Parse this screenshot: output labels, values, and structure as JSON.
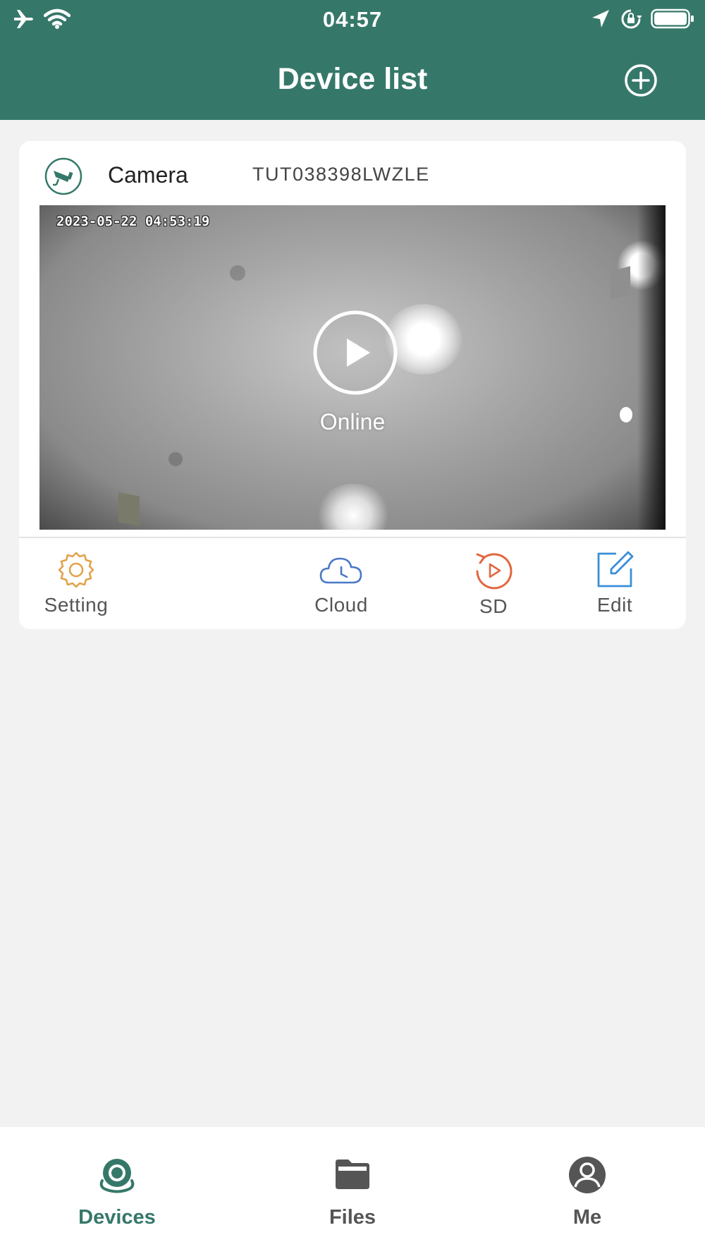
{
  "status_bar": {
    "time": "04:57"
  },
  "header": {
    "title": "Device list"
  },
  "device": {
    "name": "Camera",
    "id": "TUT038398LWZLE",
    "timestamp": "2023-05-22 04:53:19",
    "status": "Online"
  },
  "actions": {
    "setting": "Setting",
    "cloud": "Cloud",
    "sd": "SD",
    "edit": "Edit"
  },
  "tabs": {
    "devices": "Devices",
    "files": "Files",
    "me": "Me"
  },
  "colors": {
    "primary": "#357869",
    "setting_icon": "#e2a24a",
    "cloud_icon": "#4a78c6",
    "sd_icon": "#e3673f",
    "edit_icon": "#3a8fd8"
  },
  "icons": {
    "status_bar": [
      "airplane-icon",
      "wifi-icon",
      "location-icon",
      "rotation-lock-icon",
      "battery-icon"
    ],
    "header": "add-icon",
    "device": "camera-icon",
    "preview": "play-icon",
    "actions": [
      "gear-icon",
      "cloud-clock-icon",
      "replay-icon",
      "edit-icon"
    ],
    "tabs": [
      "camera-icon",
      "folder-icon",
      "user-icon"
    ]
  }
}
